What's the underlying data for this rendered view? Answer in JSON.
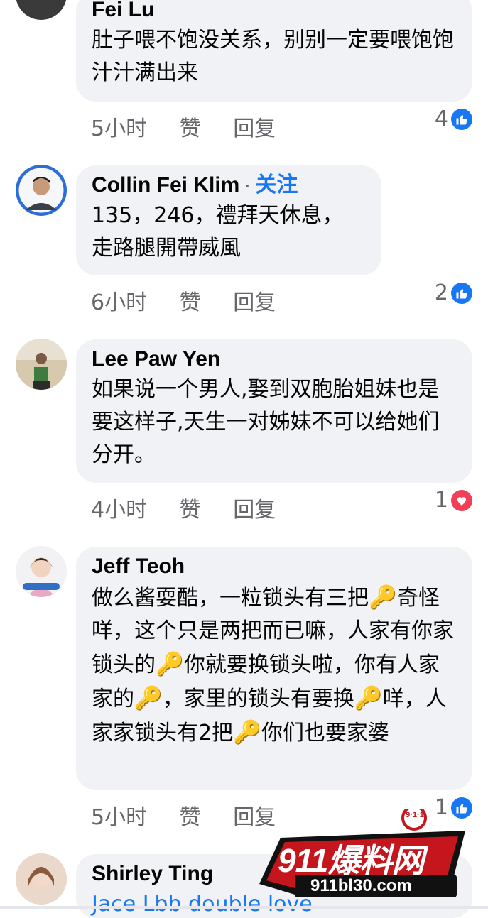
{
  "comments": [
    {
      "name": "Fei Lu",
      "text": "肚子喂不饱没关系，别别一定要喂饱饱汁汁满出来",
      "time": "5小时",
      "like_label": "赞",
      "reply_label": "回复",
      "reaction_count": "4",
      "reaction_icon": "like-icon"
    },
    {
      "name": "Collin Fei Klim",
      "follow_label": "关注",
      "text_line1": "135，246，禮拜天休息，",
      "text_line2": "走路腿開帶威風",
      "time": "6小时",
      "like_label": "赞",
      "reply_label": "回复",
      "reaction_count": "2",
      "reaction_icon": "like-icon"
    },
    {
      "name": "Lee Paw Yen",
      "text": "如果说一个男人,娶到双胞胎姐妹也是要这样子,天生一对姊妹不可以给她们 分开。",
      "time": "4小时",
      "like_label": "赞",
      "reply_label": "回复",
      "reaction_count": "1",
      "reaction_icon": "love-icon"
    },
    {
      "name": "Jeff Teoh",
      "text_parts": [
        "做么酱耍酷，一粒锁头有三把",
        "奇怪咩，这个只是两把而已嘛，人家有你家锁头的",
        "你就要换锁头啦，你有人家家的",
        "，家里的锁头有要换",
        "咩，人家家锁头有2把",
        "你们也要家婆"
      ],
      "time": "5小时",
      "like_label": "赞",
      "reply_label": "回复",
      "reaction_count": "1",
      "reaction_icon": "like-icon"
    },
    {
      "name": "Shirley Ting",
      "text": "Jace Lbb double love"
    }
  ],
  "watermark": {
    "badge": "9·1·1",
    "title": "911爆料网",
    "url": "911bl30.com"
  },
  "colors": {
    "bubble": "#f0f2f5",
    "meta": "#65676b",
    "accent": "#1877f2",
    "love": "#f33e58"
  }
}
